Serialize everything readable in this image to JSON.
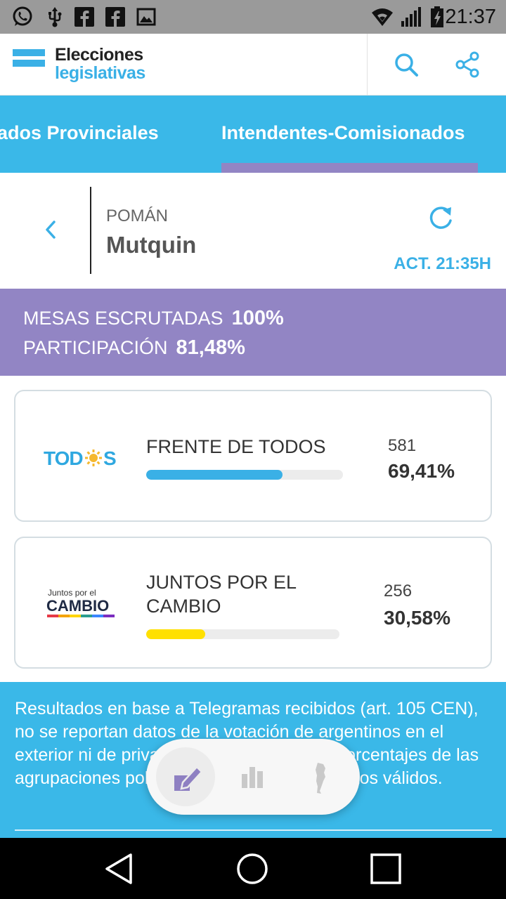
{
  "status_bar": {
    "time": "21:37",
    "left_icons": [
      "whatsapp-icon",
      "usb-icon",
      "facebook-icon",
      "facebook-icon",
      "image-icon"
    ],
    "right_icons": [
      "wifi-icon",
      "signal-icon",
      "battery-icon"
    ]
  },
  "header": {
    "title_line1": "Elecciones",
    "title_line2": "legislativas",
    "accent_color": "#3ab0e6",
    "actions": [
      "search-icon",
      "share-icon"
    ]
  },
  "tabs": {
    "items": [
      {
        "label": "ados Provinciales",
        "active": false
      },
      {
        "label": "Intendentes-Comisionados",
        "active": true
      }
    ],
    "background": "#3ab8e8",
    "indicator_color": "#9285c4"
  },
  "location": {
    "department": "POMÁN",
    "town": "Mutquin",
    "updated": "ACT. 21:35H"
  },
  "stats": {
    "mesas_label": "MESAS ESCRUTADAS",
    "mesas_value": "100%",
    "participacion_label": "PARTICIPACIÓN",
    "participacion_value": "81,48%",
    "background": "#9285c4"
  },
  "results": [
    {
      "party": "FRENTE DE TODOS",
      "logo_text": "TODOS",
      "votes": "581",
      "percent": "69,41%",
      "percent_value": 69.41,
      "bar_color": "#3ab0e6"
    },
    {
      "party": "JUNTOS POR EL CAMBIO",
      "party_line1": "JUNTOS POR EL",
      "party_line2": "CAMBIO",
      "logo_small": "Juntos por el",
      "logo_big": "CAMBIO",
      "votes": "256",
      "percent": "30,58%",
      "percent_value": 30.58,
      "bar_color": "#ffe000"
    }
  ],
  "info": {
    "text": "Resultados en base a Telegramas recibidos (art. 105 CEN), no se reportan datos de la votación de argentinos en el exterior ni de privados de la libertad. Los porcentajes de las agrupaciones políticas se calculan sobre votos válidos."
  },
  "bottom_pill": {
    "buttons": [
      "vote-icon",
      "bar-chart-icon",
      "argentina-map-icon"
    ],
    "active_color": "#8e80c2"
  },
  "nav_bar": {
    "buttons": [
      "back-triangle-icon",
      "home-circle-icon",
      "recents-square-icon"
    ]
  }
}
